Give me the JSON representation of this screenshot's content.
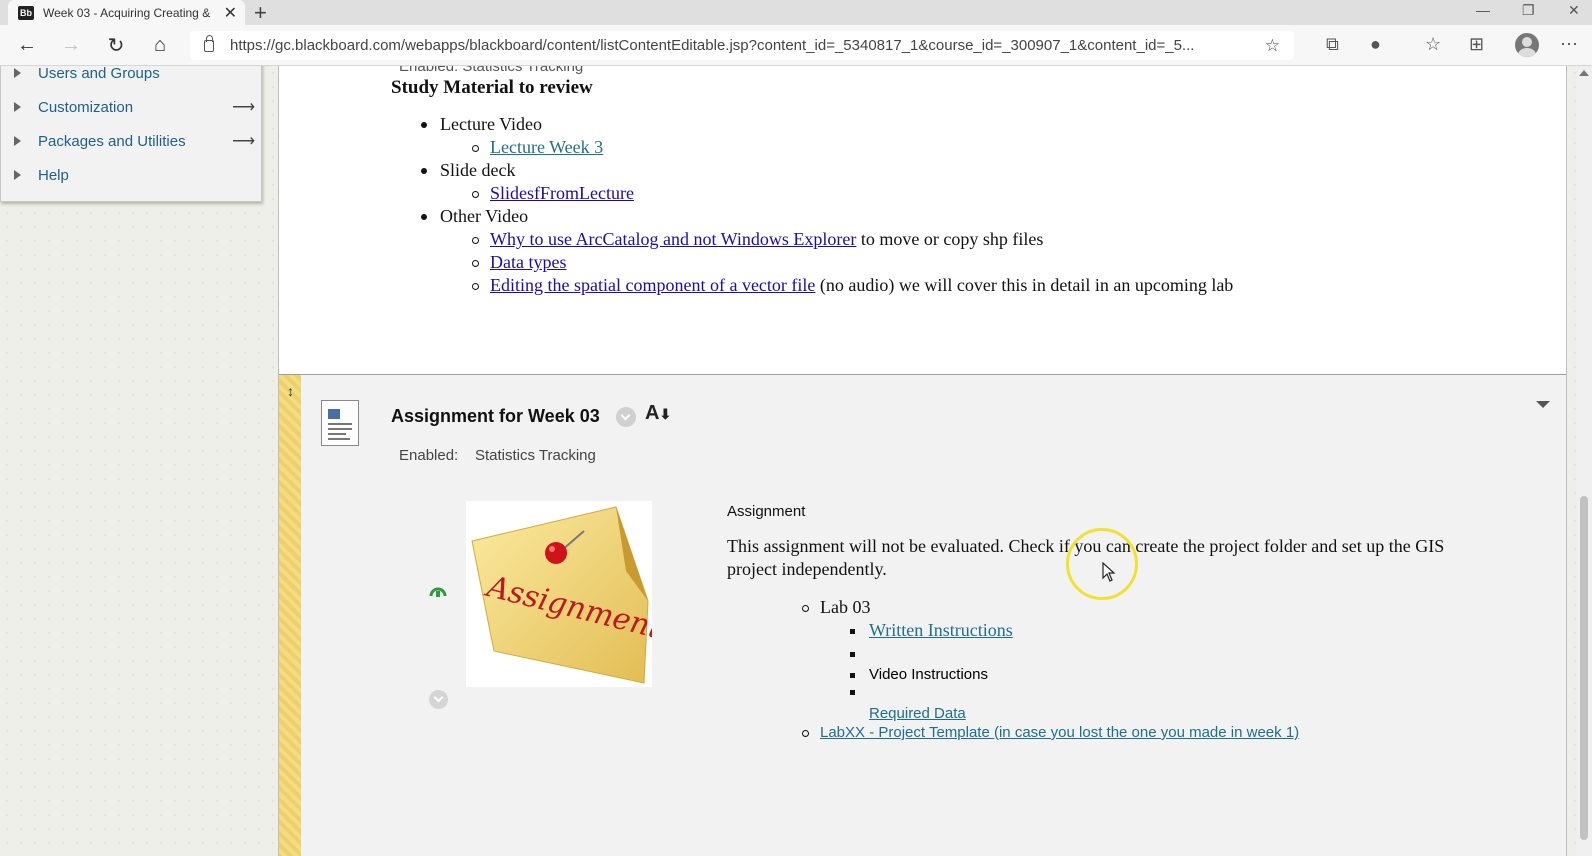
{
  "browser": {
    "tab": {
      "favicon": "Bb",
      "title": "Week 03 - Acquiring Creating &"
    },
    "url": "https://gc.blackboard.com/webapps/blackboard/content/listContentEditable.jsp?content_id=_5340817_1&course_id=_300907_1&content_id=_5..."
  },
  "sidebar": {
    "items": [
      {
        "label": "Users and Groups",
        "arrow": ""
      },
      {
        "label": "Customization",
        "arrow": "⟶"
      },
      {
        "label": "Packages and Utilities",
        "arrow": "⟶"
      },
      {
        "label": "Help",
        "arrow": ""
      }
    ]
  },
  "study": {
    "ghost_enabled": "Enabled:   Statistics Tracking",
    "title": "Study Material to review",
    "lecture_video": "Lecture Video",
    "lecture_link": "Lecture Week 3",
    "slide_deck": "Slide deck",
    "slides_link": "SlidesfFromLecture",
    "other_video": "Other Video",
    "arccatalog_link": "Why to use ArcCatalog and not Windows Explorer",
    "arccatalog_suffix": "to move or copy shp files",
    "datatypes_link": "Data types",
    "editing_link": "Editing the spatial component of a vector file",
    "editing_suffix": "(no audio) we will cover this in detail in an upcoming lab"
  },
  "assignment": {
    "title": "Assignment for Week 03",
    "enabled_label": "Enabled:",
    "enabled_value": "Statistics Tracking",
    "image_text": "Assignment",
    "heading": "Assignment",
    "description": "This assignment will not be evaluated. Check if you can create the project folder and set up the GIS project independently.",
    "lab": "Lab 03",
    "written_link": "Written Instructions",
    "video_instructions": "Video Instructions",
    "required_data_link": "Required Data",
    "template_link": "LabXX - Project Template (in case you lost the one you made in week 1)"
  },
  "icons": [
    "back-icon",
    "forward-icon",
    "refresh-icon",
    "home-icon",
    "lock-icon",
    "favorite-add-icon",
    "extension-icon",
    "favorites-icon",
    "collections-icon",
    "profile-icon",
    "more-icon",
    "document-icon",
    "font-size-icon",
    "reload-icon",
    "cursor-icon"
  ],
  "colors": {
    "link": "#1a0dab",
    "link_teal": "#1f6f8b",
    "menu_link": "#1f5f8b",
    "highlight_stripe": "#f4dc82",
    "cursor_ring": "#f0e232"
  }
}
